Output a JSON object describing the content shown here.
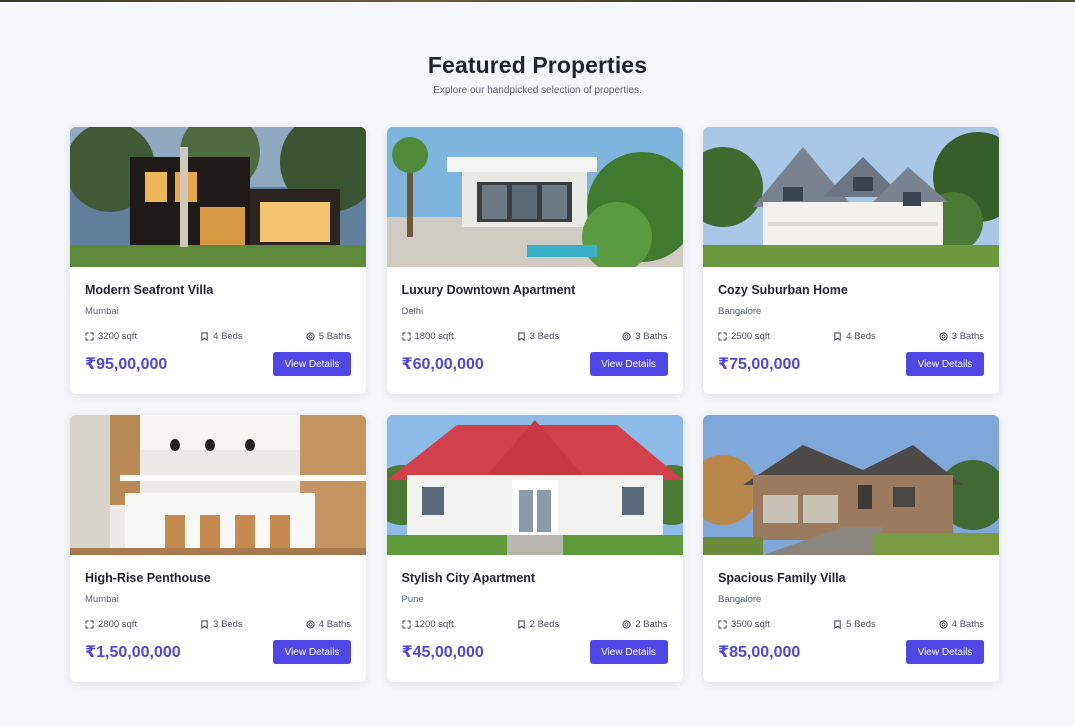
{
  "header": {
    "title": "Featured Properties",
    "subtitle": "Explore our handpicked selection of properties."
  },
  "accent_color": "#4f46e5",
  "properties": [
    {
      "title": "Modern Seafront Villa",
      "location": "Mumbai",
      "area": "3200 sqft",
      "beds": "4 Beds",
      "baths": "5 Baths",
      "price": "₹95,00,000",
      "button": "View Details",
      "image": "modern-villa-photo"
    },
    {
      "title": "Luxury Downtown Apartment",
      "location": "Delhi",
      "area": "1800 sqft",
      "beds": "3 Beds",
      "baths": "3 Baths",
      "price": "₹60,00,000",
      "button": "View Details",
      "image": "white-modern-house-photo"
    },
    {
      "title": "Cozy Suburban Home",
      "location": "Bangalore",
      "area": "2500 sqft",
      "beds": "4 Beds",
      "baths": "3 Baths",
      "price": "₹75,00,000",
      "button": "View Details",
      "image": "victorian-house-photo"
    },
    {
      "title": "High-Rise Penthouse",
      "location": "Mumbai",
      "area": "2800 sqft",
      "beds": "3 Beds",
      "baths": "4 Baths",
      "price": "₹1,50,00,000",
      "button": "View Details",
      "image": "kitchen-interior-photo"
    },
    {
      "title": "Stylish City Apartment",
      "location": "Pune",
      "area": "1200 sqft",
      "beds": "2 Beds",
      "baths": "2 Baths",
      "price": "₹45,00,000",
      "button": "View Details",
      "image": "red-roof-house-photo"
    },
    {
      "title": "Spacious Family Villa",
      "location": "Bangalore",
      "area": "3500 sqft",
      "beds": "5 Beds",
      "baths": "4 Baths",
      "price": "₹85,00,000",
      "button": "View Details",
      "image": "brick-family-house-photo"
    }
  ]
}
